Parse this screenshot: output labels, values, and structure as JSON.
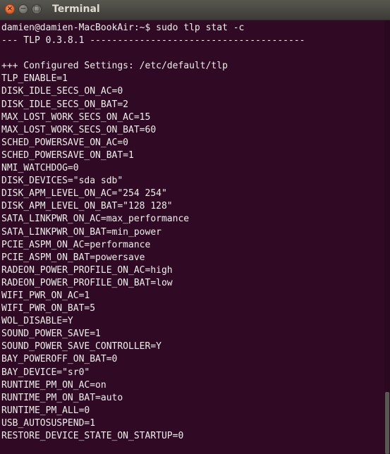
{
  "window": {
    "title": "Terminal",
    "close_glyph": "×",
    "min_glyph": "−",
    "max_glyph": "□"
  },
  "terminal": {
    "lines": [
      "damien@damien-MacBookAir:~$ sudo tlp stat -c",
      "--- TLP 0.3.8.1 ---------------------------------------",
      "",
      "+++ Configured Settings: /etc/default/tlp",
      "TLP_ENABLE=1",
      "DISK_IDLE_SECS_ON_AC=0",
      "DISK_IDLE_SECS_ON_BAT=2",
      "MAX_LOST_WORK_SECS_ON_AC=15",
      "MAX_LOST_WORK_SECS_ON_BAT=60",
      "SCHED_POWERSAVE_ON_AC=0",
      "SCHED_POWERSAVE_ON_BAT=1",
      "NMI_WATCHDOG=0",
      "DISK_DEVICES=\"sda sdb\"",
      "DISK_APM_LEVEL_ON_AC=\"254 254\"",
      "DISK_APM_LEVEL_ON_BAT=\"128 128\"",
      "SATA_LINKPWR_ON_AC=max_performance",
      "SATA_LINKPWR_ON_BAT=min_power",
      "PCIE_ASPM_ON_AC=performance",
      "PCIE_ASPM_ON_BAT=powersave",
      "RADEON_POWER_PROFILE_ON_AC=high",
      "RADEON_POWER_PROFILE_ON_BAT=low",
      "WIFI_PWR_ON_AC=1",
      "WIFI_PWR_ON_BAT=5",
      "WOL_DISABLE=Y",
      "SOUND_POWER_SAVE=1",
      "SOUND_POWER_SAVE_CONTROLLER=Y",
      "BAY_POWEROFF_ON_BAT=0",
      "BAY_DEVICE=\"sr0\"",
      "RUNTIME_PM_ON_AC=on",
      "RUNTIME_PM_ON_BAT=auto",
      "RUNTIME_PM_ALL=0",
      "USB_AUTOSUSPEND=1",
      "RESTORE_DEVICE_STATE_ON_STARTUP=0"
    ]
  }
}
